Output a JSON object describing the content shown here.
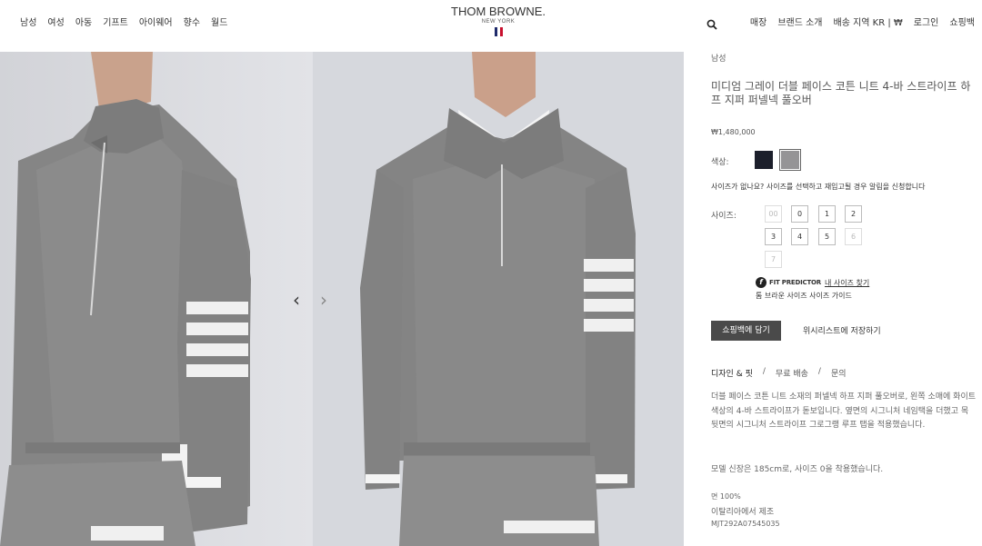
{
  "header": {
    "left_nav": [
      "남성",
      "여성",
      "아동",
      "기프트",
      "아이웨어",
      "향수",
      "월드"
    ],
    "logo": {
      "brand": "THOM BROWNE.",
      "city": "NEW YORK"
    },
    "right_nav": [
      "매장",
      "브랜드 소개",
      "배송 지역 KR | ₩",
      "로그인",
      "쇼핑백"
    ],
    "search_icon": "search-icon"
  },
  "gallery": {
    "prev_arrow": "‹",
    "next_arrow": "›"
  },
  "product": {
    "breadcrumb": "남성",
    "title": "미디엄 그레이 더블 페이스 코튼 니트 4-바 스트라이프 하프 지퍼 퍼넬넥 풀오버",
    "price": "₩1,480,000",
    "color_label": "색상:",
    "colors": [
      "#1c1f2b",
      "#959496"
    ],
    "notify_text": "사이즈가 없나요? 사이즈를 선택하고 재입고될 경우 알림을 신청합니다",
    "size_label": "사이즈:",
    "sizes": [
      "00",
      "0",
      "1",
      "2",
      "3",
      "4",
      "5",
      "6",
      "7"
    ],
    "fit_predictor": "FIT PREDICTOR",
    "fit_link": "내 사이즈 찾기",
    "size_guide": "톰 브라운 사이즈 사이즈 가이드",
    "add_to_bag": "쇼핑백에 담기",
    "wishlist": "위시리스트에 저장하기",
    "tabs": [
      "디자인 & 핏",
      "무료 배송",
      "문의"
    ],
    "description": "더블 페이스 코튼 니트 소재의 퍼넬넥 하프 지퍼 풀오버로, 왼쪽 소매에 화이트 색상의 4-바 스트라이프가 돋보입니다. 옆면의 시그니처 네임택을 더했고 목 뒷면의 시그니처 스트라이프 그로그랭 루프 탭을 적용했습니다.",
    "model_info": "모델 신장은 185cm로, 사이즈 0을 착용했습니다.",
    "fabric": "면 100%",
    "origin": "이탈리아에서 제조",
    "sku": "MJT292A07545035"
  }
}
